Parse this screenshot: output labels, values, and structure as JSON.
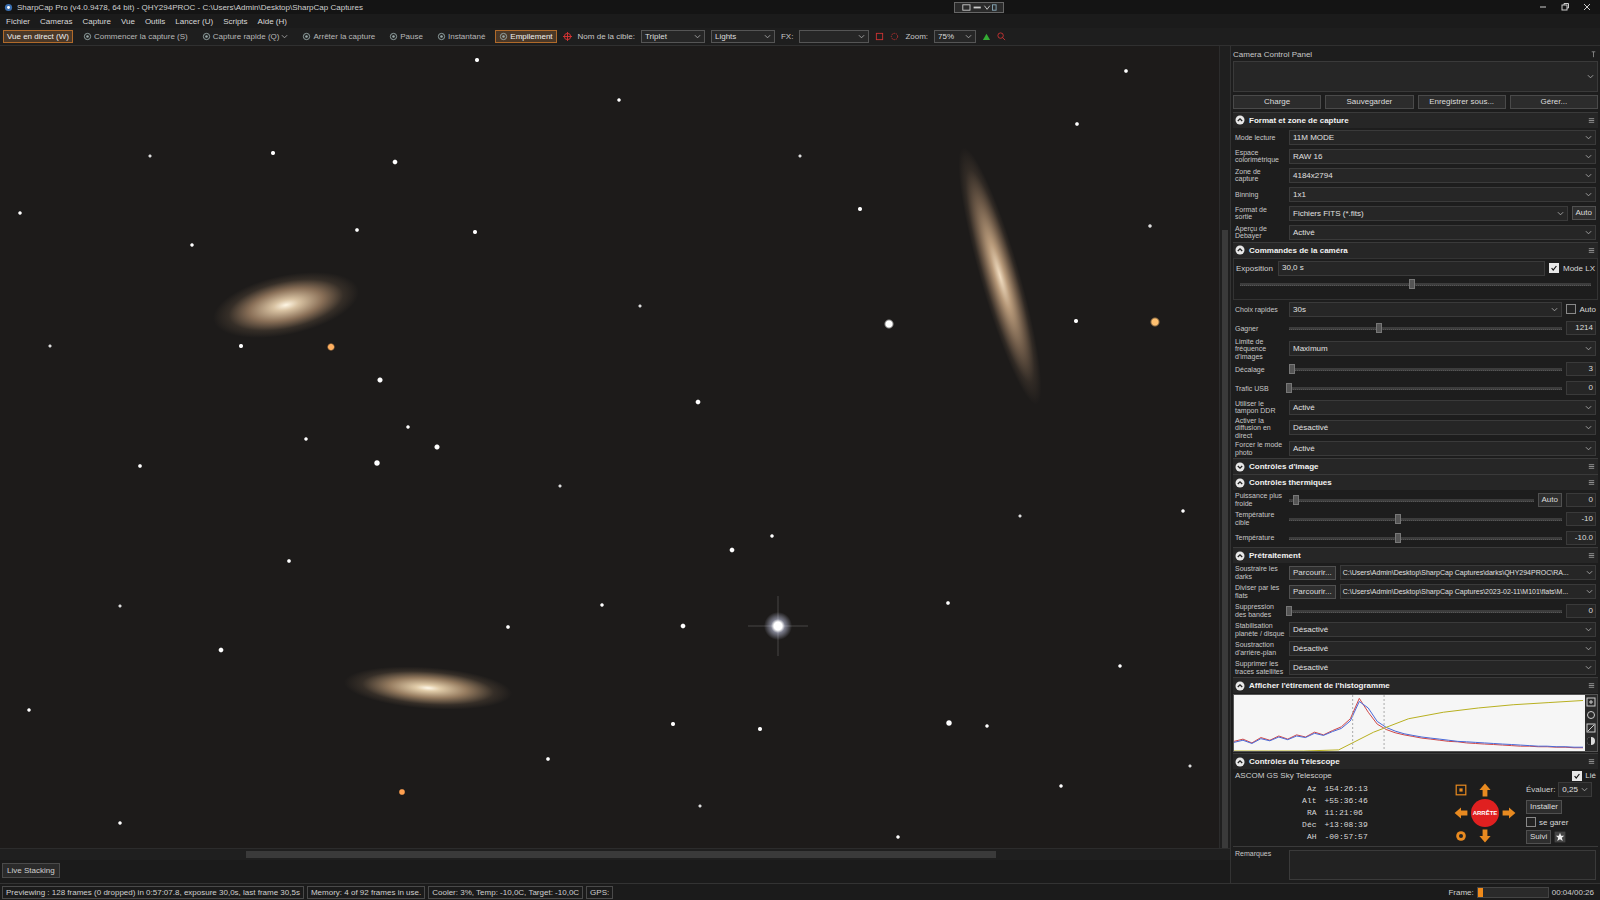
{
  "window": {
    "title": "SharpCap Pro (v4.0.9478, 64 bit) - QHY294PROC - C:\\Users\\Admin\\Desktop\\SharpCap Captures"
  },
  "menu": [
    "Fichier",
    "Cameras",
    "Capture",
    "Vue",
    "Outils",
    "Lancer (U)",
    "Scripts",
    "Aide (H)"
  ],
  "toolbar": {
    "buttons": [
      {
        "label": "Vue en direct (W)",
        "selected": true,
        "dropdown": false
      },
      {
        "label": "Commencer la capture (S)",
        "selected": false,
        "dropdown": false
      },
      {
        "label": "Capture rapide (Q)",
        "selected": false,
        "dropdown": true
      },
      {
        "label": "Arrêter la capture",
        "selected": false,
        "dropdown": false
      },
      {
        "label": "Pause",
        "selected": false,
        "dropdown": false
      },
      {
        "label": "Instantané",
        "selected": false,
        "dropdown": false
      },
      {
        "label": "Empilement",
        "selected": true,
        "dropdown": false
      }
    ],
    "target_label": "Nom de la cible:",
    "target": "Triplet",
    "frame_type": "Lights",
    "fx_label": "FX:",
    "fx": "",
    "zoom_label": "Zoom:",
    "zoom": "75%"
  },
  "viewer": {
    "scroll_h": {
      "start": 0.2,
      "size": 0.61
    },
    "scroll_v": {
      "start": 0.23,
      "size": 0.77
    },
    "tab": "Live Stacking"
  },
  "panel": {
    "title": "Camera Control Panel",
    "profile": "",
    "buttons": [
      "Charge",
      "Sauvegarder",
      "Enregistrer sous...",
      "Gérer..."
    ],
    "sections": [
      {
        "title": "Format et zone de capture",
        "expanded": true,
        "kind": "rows",
        "rows": [
          {
            "kind": "select",
            "label": "Mode lecture",
            "value": "11M MODE"
          },
          {
            "kind": "select",
            "label": "Espace colorimétrique",
            "value": "RAW 16"
          },
          {
            "kind": "select",
            "label": "Zone de capture",
            "value": "4184x2794"
          },
          {
            "kind": "select",
            "label": "Binning",
            "value": "1x1"
          },
          {
            "kind": "select-button",
            "label": "Format de sortie",
            "value": "Fichiers FITS (*.fits)",
            "button": "Auto"
          },
          {
            "kind": "select",
            "label": "Aperçu de Debayer",
            "value": "Activé"
          }
        ]
      },
      {
        "title": "Commandes de la caméra",
        "expanded": true,
        "kind": "rows",
        "rows": [
          {
            "kind": "exposure",
            "label": "Exposition",
            "value": "30,0 s",
            "check": {
              "label": "Mode LX",
              "checked": true
            },
            "level": 0.49
          },
          {
            "kind": "quick",
            "label": "Choix rapides",
            "value": "30s",
            "check": {
              "label": "Auto",
              "checked": false
            }
          },
          {
            "kind": "slider",
            "label": "Gagner",
            "level": 0.33,
            "value": "1214"
          },
          {
            "kind": "select",
            "label": "Limite de fréquence d'images",
            "value": "Maximum"
          },
          {
            "kind": "slider",
            "label": "Décalage",
            "level": 0.01,
            "value": "3"
          },
          {
            "kind": "slider",
            "label": "Trafic USB",
            "level": 0,
            "value": "0"
          },
          {
            "kind": "select",
            "label": "Utiliser le tampon DDR",
            "value": "Activé"
          },
          {
            "kind": "select",
            "label": "Activer la diffusion en direct",
            "value": "Désactivé"
          },
          {
            "kind": "select",
            "label": "Forcer le mode photo",
            "value": "Activé"
          }
        ]
      },
      {
        "title": "Contrôles d'image",
        "expanded": false,
        "kind": "rows",
        "rows": []
      },
      {
        "title": "Contrôles thermiques",
        "expanded": true,
        "kind": "rows",
        "rows": [
          {
            "kind": "slider-auto",
            "label": "Puissance plus froide",
            "level": 0.03,
            "button": "Auto",
            "value": "0"
          },
          {
            "kind": "slider",
            "label": "Température cible",
            "level": 0.4,
            "value": "-10"
          },
          {
            "kind": "slider",
            "label": "Température",
            "level": 0.4,
            "value": "-10.0"
          }
        ]
      },
      {
        "title": "Prétraitement",
        "expanded": true,
        "kind": "rows",
        "rows": [
          {
            "kind": "file",
            "label": "Soustraire les darks",
            "button": "Parcourir...",
            "value": "C:\\Users\\Admin\\Desktop\\SharpCap Captures\\darks\\QHY294PROC\\RA..."
          },
          {
            "kind": "file",
            "label": "Diviser par les flats",
            "button": "Parcourir...",
            "value": "C:\\Users\\Admin\\Desktop\\SharpCap Captures\\2023-02-11\\M101\\flats\\M..."
          },
          {
            "kind": "slider",
            "label": "Suppression des bandes",
            "level": 0,
            "value": "0"
          },
          {
            "kind": "select",
            "label": "Stabilisation planète / disque",
            "value": "Désactivé"
          },
          {
            "kind": "select",
            "label": "Soustraction d'arrière-plan",
            "value": "Désactivé"
          },
          {
            "kind": "select",
            "label": "Supprimer les traces satellites",
            "value": "Désactivé"
          }
        ]
      },
      {
        "title": "Afficher l'étirement de l'histogramme",
        "expanded": true,
        "kind": "histogram",
        "histogram": {
          "series": [
            {
              "name": "red",
              "color": "#d04848",
              "values": [
                18,
                22,
                15,
                25,
                20,
                28,
                22,
                30,
                26,
                35,
                30,
                38,
                45,
                60,
                98,
                72,
                50,
                40,
                34,
                30,
                27,
                24,
                22,
                20,
                18,
                17,
                15,
                14,
                13,
                12,
                11,
                10,
                9,
                9,
                8,
                8,
                7,
                7,
                6,
                6
              ]
            },
            {
              "name": "blue",
              "color": "#4a6ad8",
              "values": [
                16,
                20,
                14,
                23,
                19,
                26,
                21,
                28,
                25,
                33,
                29,
                36,
                42,
                56,
                92,
                80,
                55,
                44,
                37,
                32,
                29,
                26,
                24,
                22,
                20,
                18,
                17,
                16,
                15,
                14,
                13,
                12,
                11,
                10,
                9,
                9,
                8,
                8,
                7,
                7
              ]
            }
          ],
          "curve": {
            "color": "#b8b020",
            "values": [
              0,
              0,
              0,
              2,
              35,
              60,
              72,
              80,
              86,
              90,
              94
            ]
          },
          "black_point": 0.34,
          "mid_point": 0.43
        }
      },
      {
        "title": "Contrôles du Télescope",
        "expanded": true,
        "kind": "telescope",
        "telescope": {
          "driver": "ASCOM GS Sky Telescope",
          "linked": {
            "label": "Lié",
            "checked": true
          },
          "coords": [
            {
              "label": "Az",
              "value": "154:26:13"
            },
            {
              "label": "Alt",
              "value": "+55:36:46"
            },
            {
              "label": "RA",
              "value": "11:21:06"
            },
            {
              "label": "Déc",
              "value": "+13:08:39"
            },
            {
              "label": "AH",
              "value": "-00:57:57"
            }
          ],
          "stop": "ARRÊTE",
          "rate_label": "Évaluer:",
          "rate": "0,25",
          "install": "Installer",
          "park": {
            "label": "se garer",
            "checked": false
          },
          "tracking": "Suivi"
        }
      }
    ],
    "notes": {
      "label": "Remarques",
      "value": ""
    }
  },
  "status_bar": {
    "items": [
      "Previewing : 128 frames (0 dropped) in 0:57:07.8, exposure 30,0s, last frame 30,5s",
      "Memory: 4 of 92 frames in use.",
      "Cooler: 3%, Temp: -10,0C, Target: -10,0C",
      "GPS:"
    ],
    "frame_label": "Frame:",
    "frame_level": 0.08,
    "frame_time": "00:04/00:26"
  }
}
